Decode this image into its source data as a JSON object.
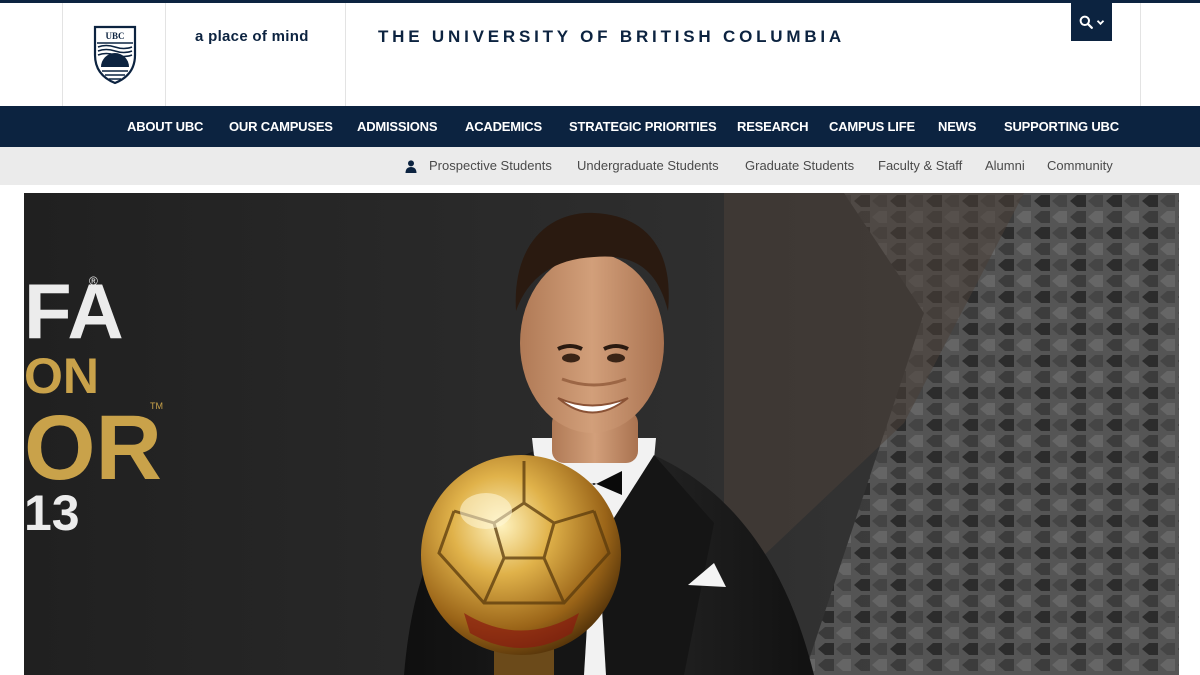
{
  "header": {
    "logo_text": "UBC",
    "tagline": "a place of mind",
    "university_name": "THE UNIVERSITY OF BRITISH COLUMBIA"
  },
  "main_nav": {
    "items": [
      {
        "label": "ABOUT UBC"
      },
      {
        "label": "OUR CAMPUSES"
      },
      {
        "label": "ADMISSIONS"
      },
      {
        "label": "ACADEMICS"
      },
      {
        "label": "STRATEGIC PRIORITIES"
      },
      {
        "label": "RESEARCH"
      },
      {
        "label": "CAMPUS LIFE"
      },
      {
        "label": "NEWS"
      },
      {
        "label": "SUPPORTING UBC"
      }
    ]
  },
  "audience_nav": {
    "icon": "person-icon",
    "items": [
      {
        "label": "Prospective Students"
      },
      {
        "label": "Undergraduate Students"
      },
      {
        "label": "Graduate Students"
      },
      {
        "label": "Faculty & Staff"
      },
      {
        "label": "Alumni"
      },
      {
        "label": "Community"
      }
    ]
  },
  "search": {
    "icon": "search-icon",
    "toggle_icon": "chevron-down-icon"
  },
  "hero": {
    "backdrop_text": {
      "line1": "FA",
      "line1_mark": "®",
      "line2": "ON",
      "line3": "OR",
      "line3_mark": "TM",
      "line4": "13"
    }
  },
  "colors": {
    "brand_navy": "#0c2340",
    "nav_text": "#ffffff",
    "audience_bar": "#ebebeb",
    "audience_text": "#4a4a4a",
    "gold": "#c9a24a"
  }
}
